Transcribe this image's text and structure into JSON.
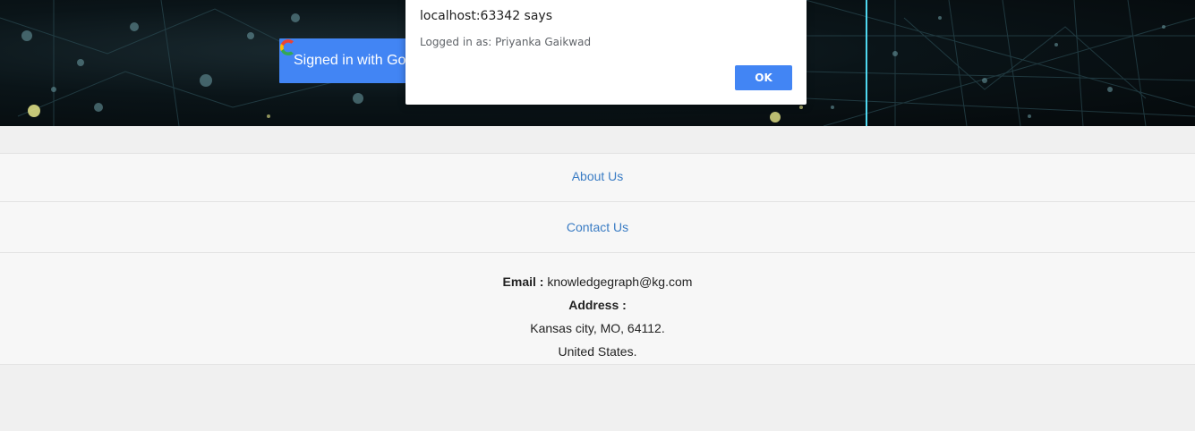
{
  "signin": {
    "label": "Signed in with Google",
    "icon": "google-icon"
  },
  "footer": {
    "about": "About Us",
    "contact": "Contact Us",
    "email_label": "Email :",
    "email_value": "knowledgegraph@kg.com",
    "address_label": "Address :",
    "address_line1": "Kansas city, MO, 64112.",
    "address_line2": "United States."
  },
  "dialog": {
    "title": "localhost:63342 says",
    "message": "Logged in as: Priyanka Gaikwad",
    "ok_label": "OK"
  },
  "colors": {
    "google_blue": "#4285f4",
    "link_blue": "#3a7cc4",
    "hero_dark": "#05090b",
    "hero_line": "#4fd8f0"
  }
}
